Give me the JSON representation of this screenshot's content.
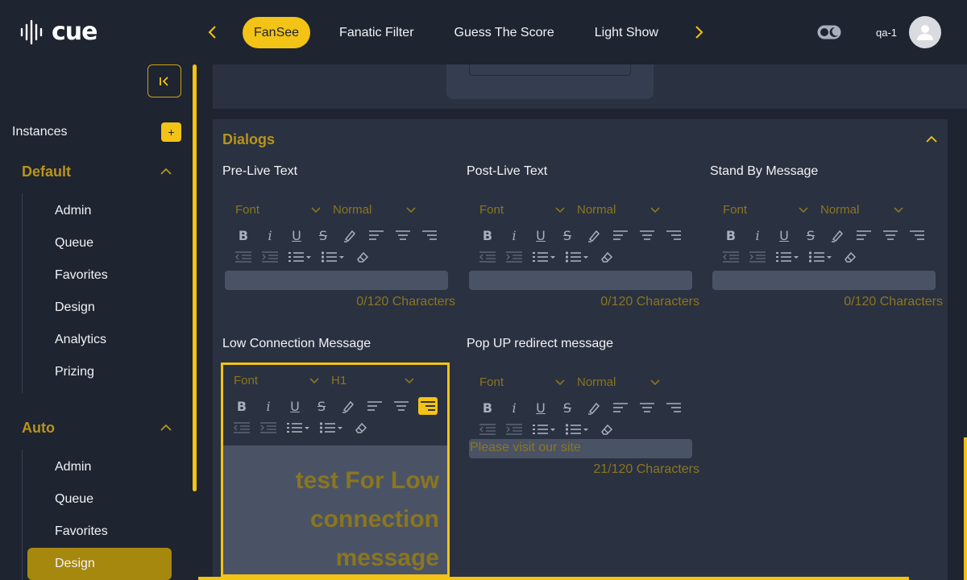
{
  "app": {
    "logo_text": "cue",
    "user_name": "qa-1"
  },
  "nav": {
    "tabs": [
      {
        "label": "FanSee",
        "active": true
      },
      {
        "label": "Fanatic Filter",
        "active": false
      },
      {
        "label": "Guess The Score",
        "active": false
      },
      {
        "label": "Light Show",
        "active": false
      }
    ]
  },
  "sidebar": {
    "instances_label": "Instances",
    "add_label": "+",
    "groups": [
      {
        "title": "Default",
        "items": [
          "Admin",
          "Queue",
          "Favorites",
          "Design",
          "Analytics",
          "Prizing"
        ]
      },
      {
        "title": "Auto",
        "items": [
          "Admin",
          "Queue",
          "Favorites",
          "Design"
        ],
        "active_item": "Design"
      }
    ]
  },
  "dialogs": {
    "title": "Dialogs",
    "fields": [
      {
        "label": "Pre-Live Text",
        "font": "Font",
        "size": "Normal",
        "text": "",
        "count": "0/120 Characters"
      },
      {
        "label": "Post-Live Text",
        "font": "Font",
        "size": "Normal",
        "text": "",
        "count": "0/120 Characters"
      },
      {
        "label": "Stand By Message",
        "font": "Font",
        "size": "Normal",
        "text": "",
        "count": "0/120 Characters"
      },
      {
        "label": "Low Connection Message",
        "font": "Font",
        "size": "H1",
        "text": "test For Low connection message",
        "count": ""
      },
      {
        "label": "Pop UP redirect message",
        "font": "Font",
        "size": "Normal",
        "text": "Please visit our site",
        "count": "21/120 Characters"
      }
    ]
  },
  "colors": {
    "accent": "#f3c315",
    "accent_dark": "#b8941a",
    "background": "#1f2431",
    "panel": "#2a3140",
    "input": "#4a5366"
  }
}
